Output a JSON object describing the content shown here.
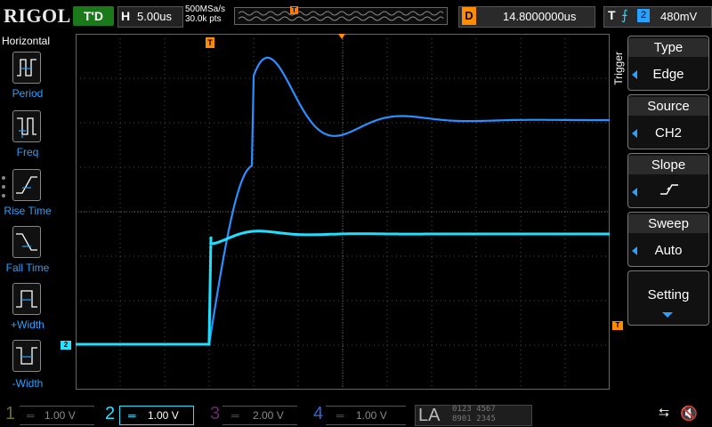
{
  "brand": {
    "logo": "RIGOL"
  },
  "top": {
    "trigger_state": "T'D",
    "horizontal_key": "H",
    "timebase": "5.00us",
    "sample_rate": "500MSa/s",
    "memory_depth": "30.0k pts",
    "memory_marker": "T",
    "delay_key": "D",
    "delay_value": "14.8000000us",
    "trigger_key": "T",
    "trigger_source": "2",
    "trigger_level": "480mV"
  },
  "left_menu": {
    "title": "Horizontal",
    "items": [
      {
        "label": "Period",
        "icon": "period-icon"
      },
      {
        "label": "Freq",
        "icon": "freq-icon"
      },
      {
        "label": "Rise Time",
        "icon": "rise-time-icon"
      },
      {
        "label": "Fall Time",
        "icon": "fall-time-icon"
      },
      {
        "label": "+Width",
        "icon": "positive-width-icon"
      },
      {
        "label": "-Width",
        "icon": "negative-width-icon"
      }
    ]
  },
  "markers": {
    "trigger_pos": "T",
    "ch2_ground": "2",
    "trigger_level": "T"
  },
  "right_menu": {
    "vertical_label": "Trigger",
    "items": [
      {
        "title": "Type",
        "value": "Edge"
      },
      {
        "title": "Source",
        "value": "CH2"
      },
      {
        "title": "Slope",
        "value": ""
      },
      {
        "title": "Sweep",
        "value": "Auto"
      }
    ],
    "setting_label": "Setting"
  },
  "channels": [
    {
      "num": "1",
      "scale": "1.00 V",
      "color": "#d6d600",
      "active": false
    },
    {
      "num": "2",
      "scale": "1.00 V",
      "color": "#2ae0ff",
      "active": true
    },
    {
      "num": "3",
      "scale": "2.00 V",
      "color": "#c040c0",
      "active": false
    },
    {
      "num": "4",
      "scale": "1.00 V",
      "color": "#2a7bff",
      "active": false
    }
  ],
  "la": {
    "label": "LA",
    "bits_top": "0123 4567",
    "bits_bottom": "8901 2345"
  },
  "colors": {
    "ch2": "#1fe0ff",
    "ref": "#2a8fff",
    "trigger": "#ff8c00"
  }
}
